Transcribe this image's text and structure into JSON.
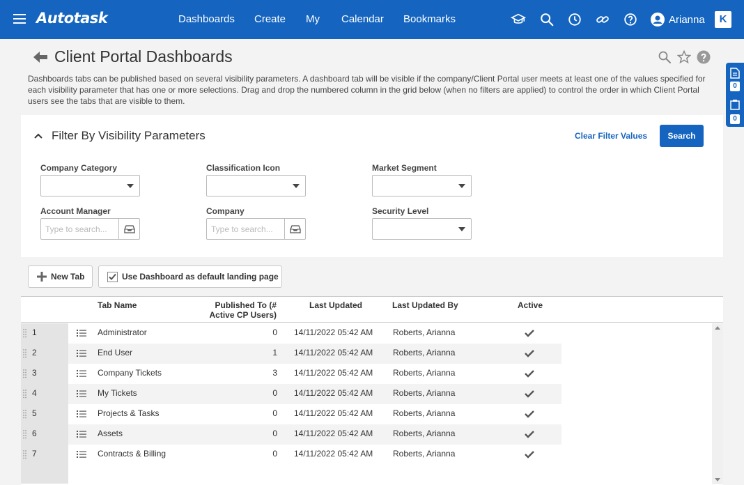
{
  "topbar": {
    "brand": "Autotask",
    "nav": [
      "Dashboards",
      "Create",
      "My",
      "Calendar",
      "Bookmarks"
    ],
    "icons": [
      "graduation-cap-icon",
      "search-icon",
      "clock-icon",
      "link-icon",
      "help-icon"
    ],
    "user_name": "Arianna",
    "k_badge": "K",
    "color": "#1565c0"
  },
  "page": {
    "title": "Client Portal Dashboards",
    "description": "Dashboards tabs can be published based on several visibility parameters. A dashboard tab will be visible if the company/Client Portal user meets at least one of the values specified for each visibility parameter that has one or more selections. Drag and drop the numbered column in the grid below (when no filters are applied) to control the order in which Client Portal users see the tabs that are visible to them."
  },
  "rail": {
    "doc_count": "0",
    "clip_count": "0"
  },
  "filter": {
    "title": "Filter By Visibility Parameters",
    "clear_label": "Clear Filter Values",
    "search_label": "Search",
    "company_category_label": "Company Category",
    "classification_icon_label": "Classification Icon",
    "market_segment_label": "Market Segment",
    "account_manager_label": "Account Manager",
    "account_manager_placeholder": "Type to search...",
    "company_label": "Company",
    "company_placeholder": "Type to search...",
    "security_level_label": "Security Level"
  },
  "toolbar": {
    "new_tab_label": "New Tab",
    "default_landing_label": "Use Dashboard as default landing page"
  },
  "grid": {
    "headers": {
      "tab_name": "Tab Name",
      "published_to_1": "Published To (#",
      "published_to_2": "Active CP Users)",
      "last_updated": "Last Updated",
      "last_updated_by": "Last Updated By",
      "active": "Active"
    },
    "rows": [
      {
        "num": "1",
        "name": "Administrator",
        "published": "0",
        "updated": "14/11/2022 05:42 AM",
        "by": "Roberts, Arianna"
      },
      {
        "num": "2",
        "name": "End User",
        "published": "1",
        "updated": "14/11/2022 05:42 AM",
        "by": "Roberts, Arianna"
      },
      {
        "num": "3",
        "name": "Company Tickets",
        "published": "3",
        "updated": "14/11/2022 05:42 AM",
        "by": "Roberts, Arianna"
      },
      {
        "num": "4",
        "name": "My Tickets",
        "published": "0",
        "updated": "14/11/2022 05:42 AM",
        "by": "Roberts, Arianna"
      },
      {
        "num": "5",
        "name": "Projects & Tasks",
        "published": "0",
        "updated": "14/11/2022 05:42 AM",
        "by": "Roberts, Arianna"
      },
      {
        "num": "6",
        "name": "Assets",
        "published": "0",
        "updated": "14/11/2022 05:42 AM",
        "by": "Roberts, Arianna"
      },
      {
        "num": "7",
        "name": "Contracts & Billing",
        "published": "0",
        "updated": "14/11/2022 05:42 AM",
        "by": "Roberts, Arianna"
      }
    ]
  }
}
